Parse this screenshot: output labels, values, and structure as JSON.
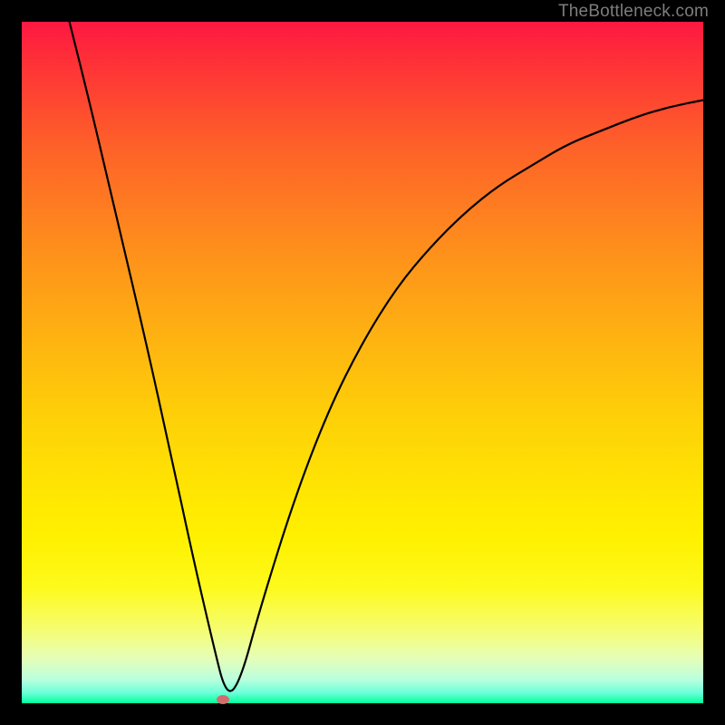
{
  "watermark": "TheBottleneck.com",
  "chart_data": {
    "type": "line",
    "title": "",
    "xlabel": "",
    "ylabel": "",
    "xlim": [
      0,
      100
    ],
    "ylim": [
      0,
      100
    ],
    "grid": false,
    "legend": false,
    "series": [
      {
        "name": "bottleneck-curve",
        "x": [
          7,
          10,
          14,
          18,
          22,
          25,
          28,
          30,
          32,
          35,
          40,
          45,
          50,
          55,
          60,
          65,
          70,
          75,
          80,
          85,
          90,
          95,
          100
        ],
        "values": [
          100,
          88,
          71,
          54,
          36,
          22,
          9,
          1,
          3,
          14,
          30,
          43,
          53,
          61,
          67,
          72,
          76,
          79,
          82,
          84,
          86,
          87.5,
          88.5
        ]
      }
    ],
    "marker": {
      "x": 29.5,
      "y": 0.5
    },
    "background_gradient_note": "vertical red-yellow-green heat gradient",
    "colors": {
      "curve": "#000000",
      "marker": "#d36d6d",
      "frame": "#000000"
    }
  }
}
